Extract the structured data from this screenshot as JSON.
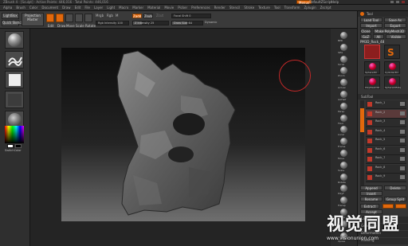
{
  "titlebar": {
    "title": "ZBrush 4 · [Sculpt] · Active Points: 446,016 · Total Points: 446,016",
    "right_items": [
      "Menus",
      "DefaultZScript",
      "Help"
    ]
  },
  "menubar": {
    "items": [
      "Alpha",
      "Brush",
      "Color",
      "Document",
      "Draw",
      "Edit",
      "File",
      "Layer",
      "Light",
      "Macro",
      "Marker",
      "Material",
      "Movie",
      "Picker",
      "Preferences",
      "Render",
      "Stencil",
      "Stroke",
      "Texture",
      "Tool",
      "Transform",
      "Zplugin",
      "Zscript"
    ]
  },
  "toolbar": {
    "lightbox": "LightBox",
    "projection": "Projection Master",
    "quicksketch": "Quick Sketch",
    "edit": "Edit",
    "draw": "Draw",
    "move": "Move",
    "scale": "Scale",
    "rotate": "Rotate",
    "mrgb": "Mrgb",
    "rgb": "Rgb",
    "m": "M",
    "rgb_intensity": "Rgb Intensity 100",
    "zadd": "Zadd",
    "zsub": "Zsub",
    "zcut": "Zcut",
    "z_intensity": "Z Intensity 25",
    "focal_shift": "Focal Shift 0",
    "draw_size": "Draw Size 64",
    "dynamic": "Dynamic",
    "z_intensity_level": 0.25,
    "draw_size_level": 0.5
  },
  "right_shelf": {
    "items": [
      "BPR",
      "SPix",
      "Scroll",
      "Zoom",
      "Actual",
      "AAHalf",
      "Persp",
      "Floor",
      "Local",
      "Frame",
      "Move",
      "Scale",
      "Rotate",
      "PolyF",
      "Transp",
      "Ghost",
      "Solo",
      "Xpose"
    ]
  },
  "tool_palette": {
    "header": "Tool",
    "load_tool": "Load Tool",
    "save_as": "Save As",
    "import": "Import",
    "export": "Export",
    "clone": "Clone",
    "make_polymesh": "Make PolyMesh3D",
    "goz": "GoZ",
    "all": "All",
    "visible": "Visible",
    "current_tool": "PM3D_Rock_48",
    "thumbnails": [
      "PM3D_Rock",
      "Simple Brush",
      "Sphere3D",
      "Cylinder3D",
      "PolyMesh3D",
      "SphereInflate"
    ],
    "subtool_header": "SubTool",
    "subtools": [
      "Rock_1",
      "Rock_2",
      "Rock_3",
      "Rock_4",
      "Rock_5",
      "Rock_6",
      "Rock_7",
      "Rock_8",
      "Rock_9"
    ],
    "append": "Append",
    "insert": "Insert",
    "delete": "Delete",
    "rename": "Rename",
    "group_split": "Group Split",
    "extract": "Extract",
    "accept": "Accept",
    "sections": [
      "Layers",
      "Geometry",
      "Deformation",
      "Masking"
    ]
  },
  "left_shelf": {
    "swatch_label": "SwitchColor"
  },
  "watermark": {
    "cn": "视觉同盟",
    "url": "www.visionunion.com"
  },
  "accent": "#e2680c"
}
